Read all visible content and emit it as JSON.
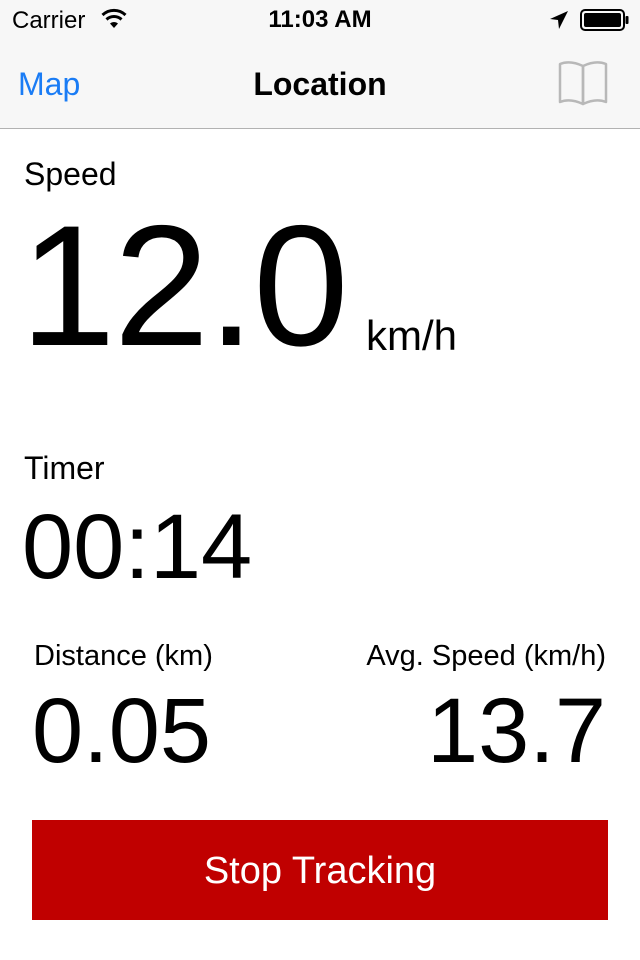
{
  "status_bar": {
    "carrier": "Carrier",
    "time": "11:03 AM",
    "icons": [
      "wifi-icon",
      "location-arrow-icon",
      "battery-icon"
    ]
  },
  "nav": {
    "back_label": "Map",
    "title": "Location",
    "right_icon": "book-icon"
  },
  "speed": {
    "label": "Speed",
    "value": "12.0",
    "unit": "km/h"
  },
  "timer": {
    "label": "Timer",
    "value": "00:14"
  },
  "distance": {
    "label": "Distance (km)",
    "value": "0.05"
  },
  "avg_speed": {
    "label": "Avg. Speed (km/h)",
    "value": "13.7"
  },
  "actions": {
    "stop_label": "Stop Tracking"
  },
  "colors": {
    "accent": "#1a7cf5",
    "stop_button": "#c00000",
    "bar_background": "#f7f7f7"
  }
}
